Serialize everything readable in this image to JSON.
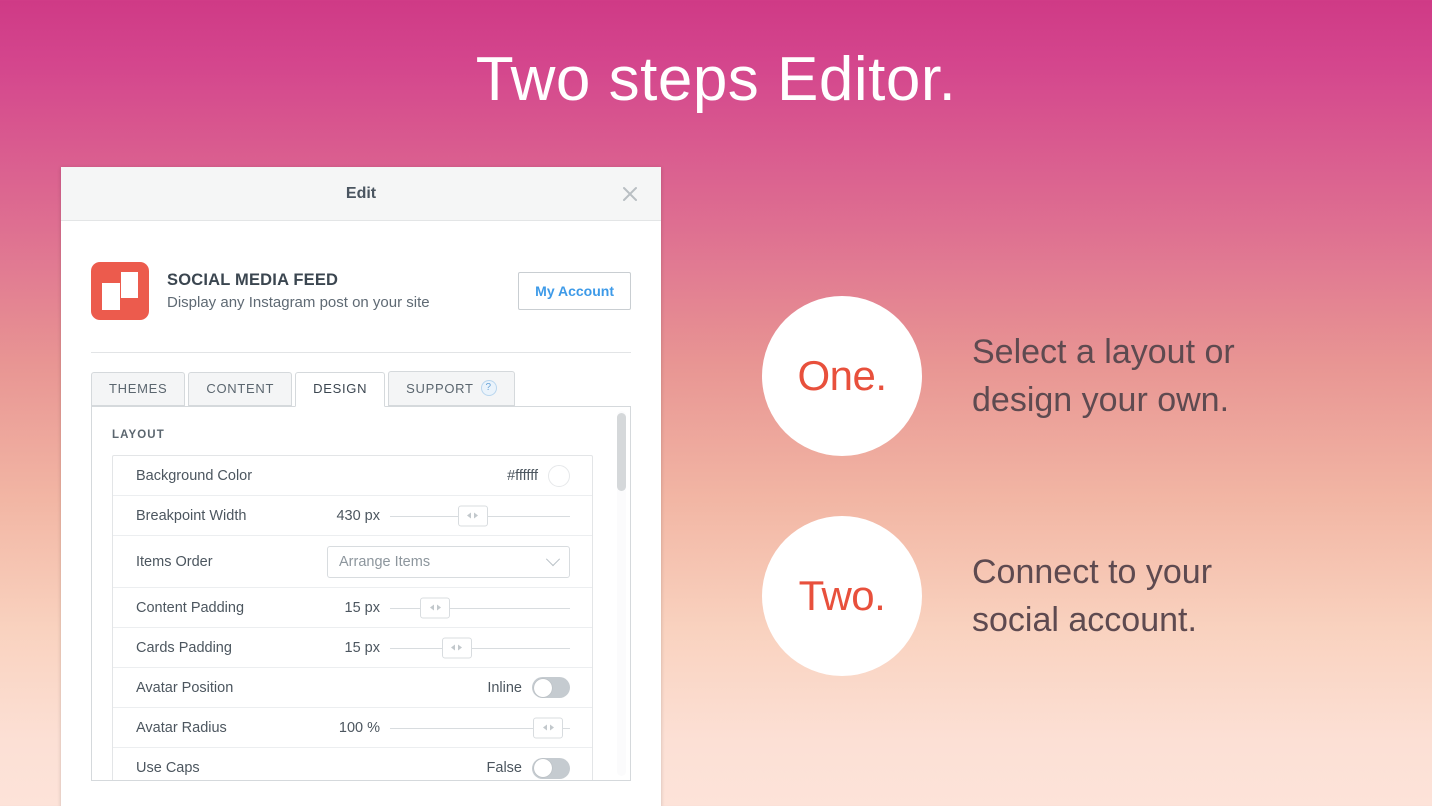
{
  "hero": {
    "title": "Two steps Editor."
  },
  "theme": {
    "gradient_top": "#cf3a86",
    "gradient_bottom": "#fde3d9",
    "accent_red": "#ec5b4d",
    "accent_blue": "#3d9ae8",
    "step_number_color": "#e8503c",
    "step_text_color": "#5e4a50"
  },
  "editor": {
    "window_title": "Edit",
    "close_icon": "close-icon",
    "app": {
      "icon": "social-media-feed-app-icon",
      "name": "SOCIAL MEDIA FEED",
      "description": "Display any Instagram post on your site",
      "account_button": "My Account"
    },
    "tabs": [
      {
        "label": "THEMES",
        "active": false,
        "badge": null
      },
      {
        "label": "CONTENT",
        "active": false,
        "badge": null
      },
      {
        "label": "DESIGN",
        "active": true,
        "badge": null
      },
      {
        "label": "SUPPORT",
        "active": false,
        "badge": "?"
      }
    ],
    "section_label": "LAYOUT",
    "settings": [
      {
        "label": "Background Color",
        "control": "color",
        "value": "#ffffff",
        "swatch": "#ffffff"
      },
      {
        "label": "Breakpoint Width",
        "control": "slider",
        "value": "430 px",
        "position_pct": 46
      },
      {
        "label": "Items Order",
        "control": "dropdown",
        "value": "Arrange Items",
        "chevron": "chevron-down-icon"
      },
      {
        "label": "Content Padding",
        "control": "slider",
        "value": "15 px",
        "position_pct": 25
      },
      {
        "label": "Cards Padding",
        "control": "slider",
        "value": "15 px",
        "position_pct": 37
      },
      {
        "label": "Avatar Position",
        "control": "toggle",
        "value": "Inline",
        "on": false
      },
      {
        "label": "Avatar Radius",
        "control": "slider",
        "value": "100 %",
        "position_pct": 88
      },
      {
        "label": "Use Caps",
        "control": "toggle",
        "value": "False",
        "on": false
      }
    ]
  },
  "steps": [
    {
      "number": "One.",
      "text": "Select a layout or\ndesign your own."
    },
    {
      "number": "Two.",
      "text": "Connect to your\nsocial account."
    }
  ]
}
